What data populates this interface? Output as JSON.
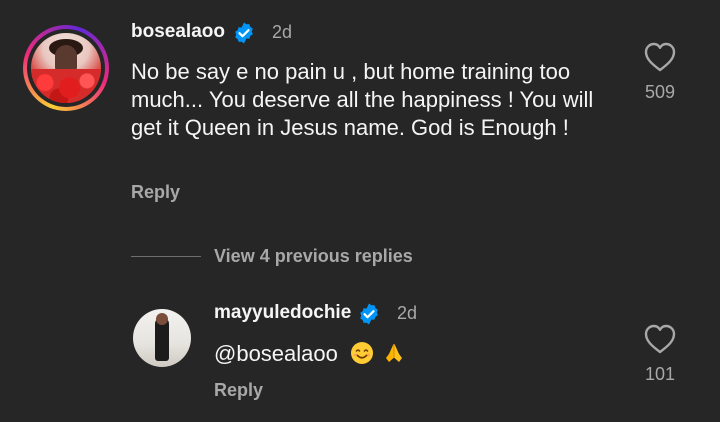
{
  "comment": {
    "username": "bosealaoo",
    "time": "2d",
    "text": "No be say e no pain u , but home training too much... You deserve all the happiness ! You will get it Queen in Jesus name. God is Enough !",
    "reply_label": "Reply",
    "likes": "509",
    "verified": true
  },
  "thread": {
    "view_previous_label": "View 4 previous replies"
  },
  "reply": {
    "username": "mayyuledochie",
    "time": "2d",
    "text": "@bosealaoo",
    "emojis": [
      "smiling-face-emoji",
      "folded-hands-emoji"
    ],
    "reply_label": "Reply",
    "likes": "101",
    "verified": true
  },
  "colors": {
    "background": "#262626",
    "primary_text": "#f5f5f5",
    "secondary_text": "#a8a8a8",
    "verified_blue": "#0095f6"
  }
}
